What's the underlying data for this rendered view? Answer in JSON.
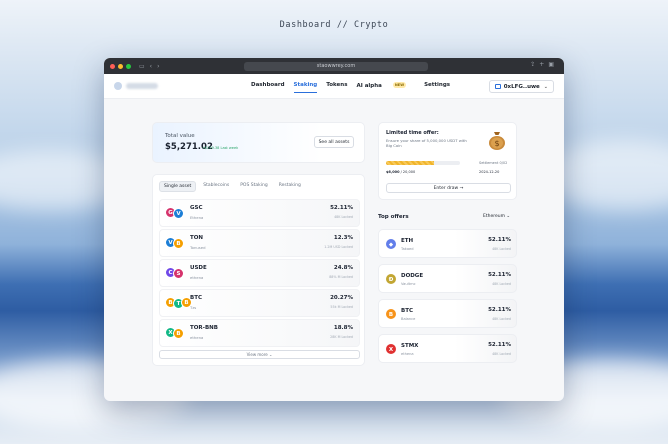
{
  "page_title": "Dashboard // Crypto",
  "browser": {
    "url": "staowwrey.com",
    "dots": [
      "#ff5f57",
      "#febc2e",
      "#28c840"
    ]
  },
  "nav": {
    "links": [
      "Dashboard",
      "Staking",
      "Tokens",
      "AI alpha",
      "Settings"
    ],
    "active": "Staking",
    "ai_badge": "NEW",
    "wallet": "0xLFG..uwe"
  },
  "total": {
    "label": "Total value",
    "value": "$5,271.02",
    "change": "+$129.38 Last week",
    "see_all": "See all assets"
  },
  "tabs": [
    "Single asset",
    "Stablecoins",
    "POS Staking",
    "Restaking"
  ],
  "assets": [
    {
      "name": "GSC",
      "network": "Ethena",
      "apy": "52.11%",
      "locked": "48K Locked",
      "coins": [
        {
          "g": "G",
          "c": "#d6336c"
        },
        {
          "g": "V",
          "c": "#1c7ed6"
        }
      ]
    },
    {
      "name": "TON",
      "network": "Tonused",
      "apy": "12.3%",
      "locked": "1.2M USD Locked",
      "coins": [
        {
          "g": "V",
          "c": "#1c7ed6"
        },
        {
          "g": "B",
          "c": "#f59f00"
        }
      ]
    },
    {
      "name": "USDE",
      "network": "ethena",
      "apy": "24.8%",
      "locked": "88% M Locked",
      "coins": [
        {
          "g": "C",
          "c": "#7048e8"
        },
        {
          "g": "S",
          "c": "#d6336c"
        }
      ]
    },
    {
      "name": "BTC",
      "network": "Tzs",
      "apy": "20.27%",
      "locked": "55k M Locked",
      "coins": [
        {
          "g": "B",
          "c": "#f59f00"
        },
        {
          "g": "T",
          "c": "#12b886"
        },
        {
          "g": "B",
          "c": "#f59f00"
        }
      ]
    },
    {
      "name": "TOR-BNB",
      "network": "ethena",
      "apy": "18.8%",
      "locked": "28K M Locked",
      "coins": [
        {
          "g": "X",
          "c": "#12b886"
        },
        {
          "g": "B",
          "c": "#f59f00"
        }
      ]
    }
  ],
  "view_more": "View more",
  "offer": {
    "title": "Limited time offer:",
    "desc": "Ensure your share of 5,000,000 USDT with Big Coin",
    "progress": 0.65,
    "progress_value": "$6,000",
    "progress_total": "/ 20,000",
    "remain_label": "Settlement 0/02",
    "date": "2024-12-20",
    "button": "Enter draw"
  },
  "top_offers": {
    "title": "Top offers",
    "network": "Ethereum",
    "items": [
      {
        "name": "ETH",
        "network": "Takaed",
        "apy": "52.11%",
        "locked": "48K Locked",
        "glyph": "◆",
        "color": "#627eea"
      },
      {
        "name": "DODGE",
        "network": "Vaultmc",
        "apy": "52.11%",
        "locked": "48K Locked",
        "glyph": "Ð",
        "color": "#c2a633"
      },
      {
        "name": "BTC",
        "network": "Balance",
        "apy": "52.11%",
        "locked": "48K Locked",
        "glyph": "B",
        "color": "#f7931a"
      },
      {
        "name": "STMX",
        "network": "ethena",
        "apy": "52.11%",
        "locked": "48K Locked",
        "glyph": "X",
        "color": "#e03131"
      }
    ]
  }
}
